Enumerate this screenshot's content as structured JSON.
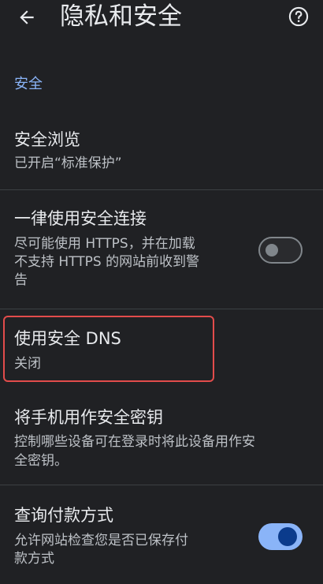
{
  "header": {
    "title": "隐私和安全",
    "back_icon": "arrow-back-icon",
    "help_icon": "help-circle-icon"
  },
  "section": {
    "label": "安全"
  },
  "items": [
    {
      "title": "安全浏览",
      "subtitle": "已开启“标准保护”"
    },
    {
      "title": "一律使用安全连接",
      "subtitle_lines": [
        "尽可能使用 HTTPS，并在加载",
        "不支持 HTTPS 的网站前收到警",
        "告"
      ],
      "toggle": "off"
    },
    {
      "title": "使用安全 DNS",
      "subtitle": "关闭"
    },
    {
      "title": "将手机用作安全密钥",
      "subtitle_lines": [
        "控制哪些设备可在登录时将此设备用作安",
        "全密钥。"
      ]
    },
    {
      "title": "查询付款方式",
      "subtitle_lines": [
        "允许网站检查您是否已保存付",
        "款方式"
      ],
      "toggle": "on"
    }
  ],
  "colors": {
    "background": "#202124",
    "accent": "#8ab4f8",
    "highlight": "#e24c4b"
  }
}
